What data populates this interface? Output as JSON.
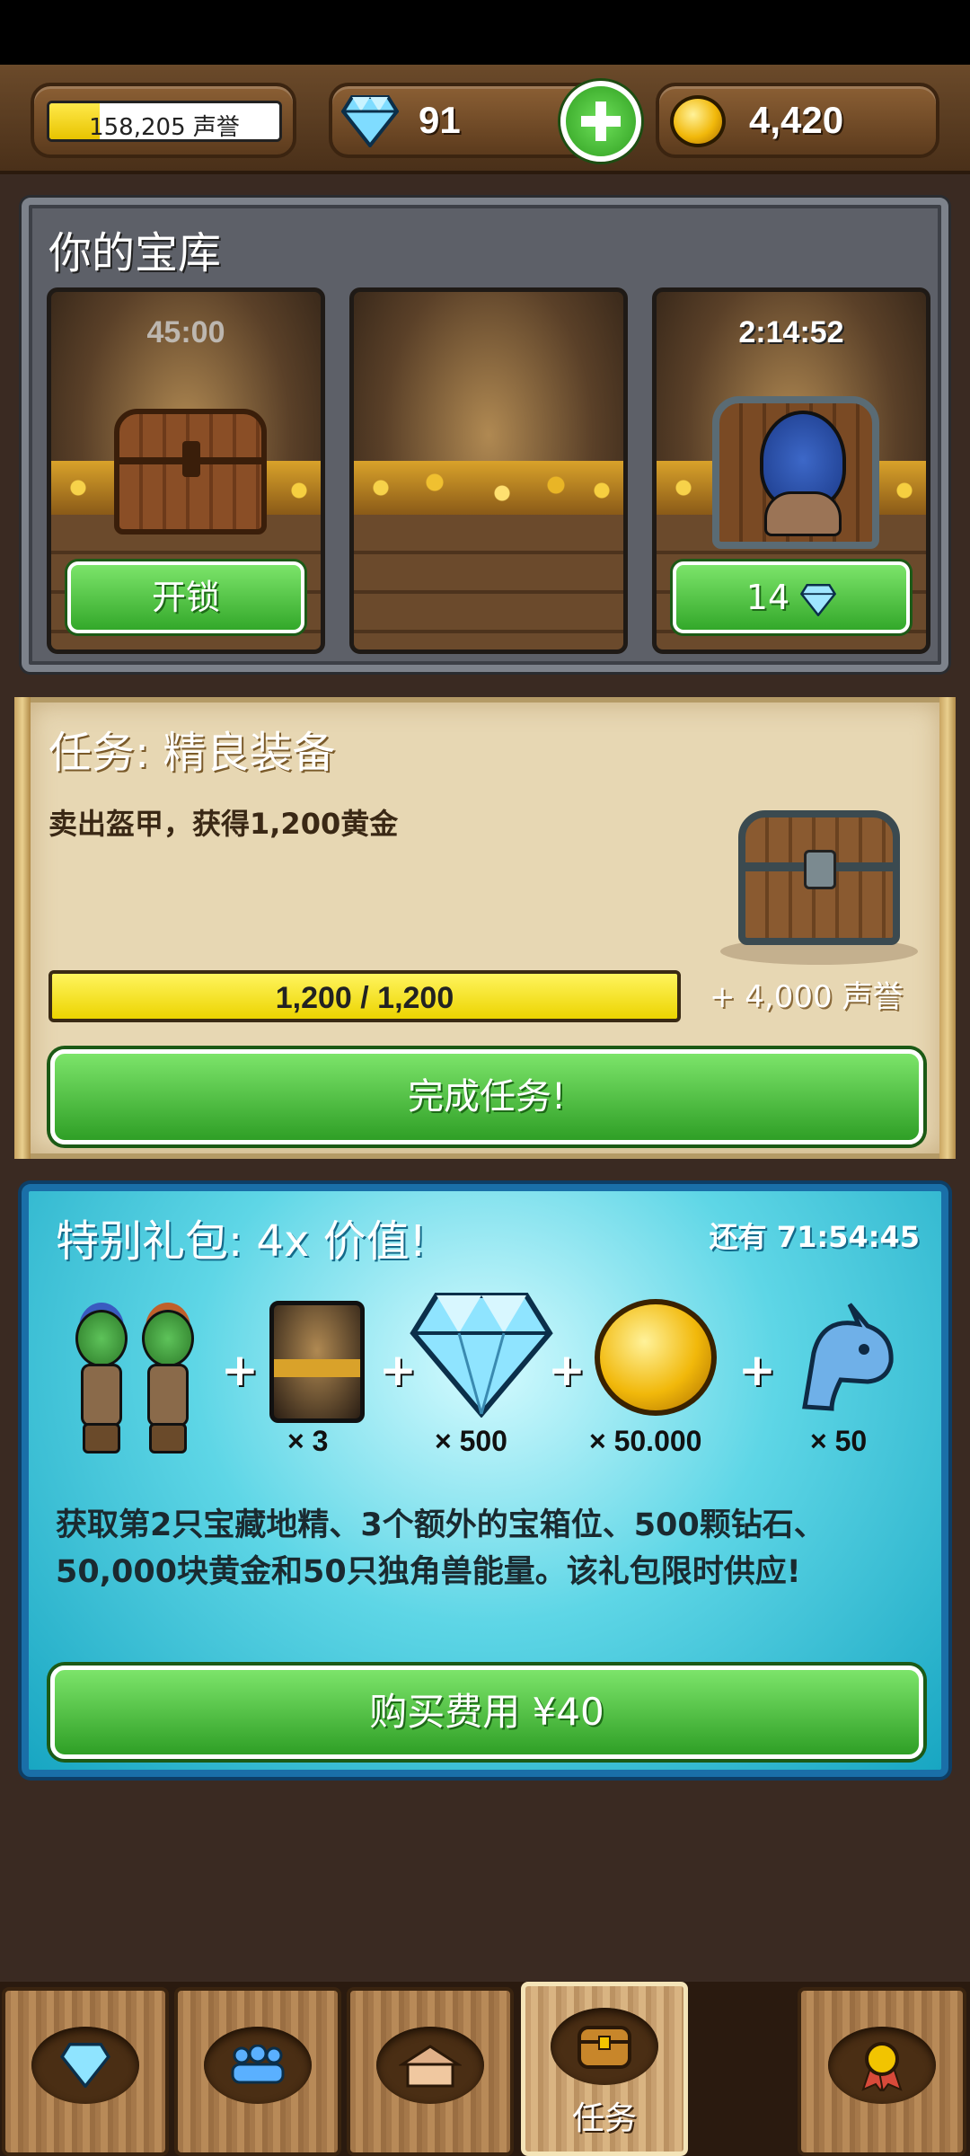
{
  "topbar": {
    "reputation_text": "158,205 声誉",
    "reputation_progress": 0.22,
    "gems": "91",
    "gold": "4,420"
  },
  "vault": {
    "title": "你的宝库",
    "slots": [
      {
        "timer": "45:00",
        "button": "开锁"
      },
      {
        "timer": "",
        "button": ""
      },
      {
        "timer": "2:14:52",
        "button": "14"
      }
    ]
  },
  "mission": {
    "title": "任务: 精良装备",
    "description": "卖出盔甲，获得1,200黄金",
    "progress_text": "1,200 / 1,200",
    "progress": 1.0,
    "reward": "+ 4,000 声誉",
    "complete_button": "完成任务!"
  },
  "pack": {
    "title": "特别礼包: 4x 价值!",
    "timer": "还有 71:54:45",
    "items": [
      {
        "icon": "goblins-icon",
        "count": ""
      },
      {
        "icon": "vault-slot-icon",
        "count": "× 3"
      },
      {
        "icon": "diamond-icon",
        "count": "× 500"
      },
      {
        "icon": "gold-coin-icon",
        "count": "× 50.000"
      },
      {
        "icon": "unicorn-icon",
        "count": "× 50"
      }
    ],
    "description": "获取第2只宝藏地精、3个额外的宝箱位、500颗钻石、50,000块黄金和50只独角兽能量。该礼包限时供应!",
    "buy_button": "购买费用 ¥40"
  },
  "bottomnav": {
    "tabs": [
      {
        "icon": "diamond-icon",
        "label": ""
      },
      {
        "icon": "people-icon",
        "label": ""
      },
      {
        "icon": "buildings-icon",
        "label": ""
      },
      {
        "icon": "chest-icon",
        "label": "任务",
        "active": true
      },
      {
        "icon": "medal-icon",
        "label": ""
      }
    ]
  },
  "colors": {
    "accent_green": "#33a82a",
    "gold": "#f1b80a",
    "pack_bg": "#5ed6e6"
  }
}
